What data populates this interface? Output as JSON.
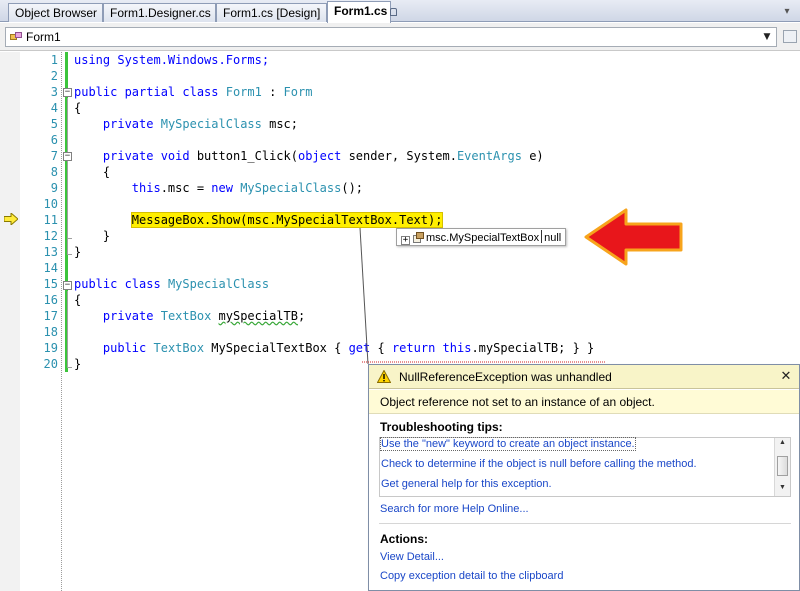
{
  "tabs": [
    {
      "label": "Object Browser",
      "active": false
    },
    {
      "label": "Form1.Designer.cs",
      "active": false
    },
    {
      "label": "Form1.cs [Design]",
      "active": false
    },
    {
      "label": "Form1.cs",
      "active": true
    }
  ],
  "member_combo": {
    "value": "Form1"
  },
  "code_lines": [
    {
      "num": "1"
    },
    {
      "num": "2"
    },
    {
      "num": "3"
    },
    {
      "num": "4"
    },
    {
      "num": "5"
    },
    {
      "num": "6"
    },
    {
      "num": "7"
    },
    {
      "num": "8"
    },
    {
      "num": "9"
    },
    {
      "num": "10"
    },
    {
      "num": "11"
    },
    {
      "num": "12"
    },
    {
      "num": "13"
    },
    {
      "num": "14"
    },
    {
      "num": "15"
    },
    {
      "num": "16"
    },
    {
      "num": "17"
    },
    {
      "num": "18"
    },
    {
      "num": "19"
    },
    {
      "num": "20"
    }
  ],
  "code": {
    "l1": "using System.Windows.Forms;",
    "l3_a": "public partial class",
    "l3_b": "Form1",
    "l3_c": " : ",
    "l3_d": "Form",
    "l4": "{",
    "l5_a": "private",
    "l5_b": "MySpecialClass",
    "l5_c": " msc;",
    "l7_a": "private void",
    "l7_b": " button1_Click(",
    "l7_c": "object",
    "l7_d": " sender, System.",
    "l7_e": "EventArgs",
    "l7_f": " e)",
    "l8": "{",
    "l9_a": "this",
    "l9_b": ".msc = ",
    "l9_c": "new",
    "l9_d": "MySpecialClass",
    "l9_e": "();",
    "l11": "MessageBox.Show(msc.MySpecialTextBox.Text);",
    "l12": "}",
    "l13": "}",
    "l15_a": "public class",
    "l15_b": "MySpecialClass",
    "l16": "{",
    "l17_a": "private",
    "l17_b": "TextBox",
    "l17_c": "mySpecialTB",
    "l17_d": ";",
    "l19_a": "public",
    "l19_b": "TextBox",
    "l19_c": " MySpecialTextBox { ",
    "l19_d": "get",
    "l19_e": " { ",
    "l19_f": "return",
    "l19_g": "this",
    "l19_h": ".mySpecialTB; } }",
    "l20": "}"
  },
  "datatip": {
    "expression": "msc.MySpecialTextBox",
    "value": "null"
  },
  "exception": {
    "title": "NullReferenceException was unhandled",
    "message": "Object reference not set to an instance of an object.",
    "tips_heading": "Troubleshooting tips:",
    "tips": [
      "Use the \"new\" keyword to create an object instance.",
      "Check to determine if the object is null before calling the method.",
      "Get general help for this exception."
    ],
    "search_link": "Search for more Help Online...",
    "actions_heading": "Actions:",
    "actions": [
      "View Detail...",
      "Copy exception detail to the clipboard"
    ],
    "close": "✕"
  },
  "icons": {
    "tab_pin": "pin-icon",
    "combo_arrow": "▼",
    "exec_pointer": "execution-pointer-icon",
    "warning": "warning-icon",
    "red_arrow": "red-arrow-annotation"
  },
  "colors": {
    "keyword": "#0000ff",
    "type": "#2b91af",
    "highlight": "#ffef00",
    "link": "#1a47c8",
    "exception_header": "#f8f4c8",
    "annotation_arrow": "#e8161b"
  }
}
